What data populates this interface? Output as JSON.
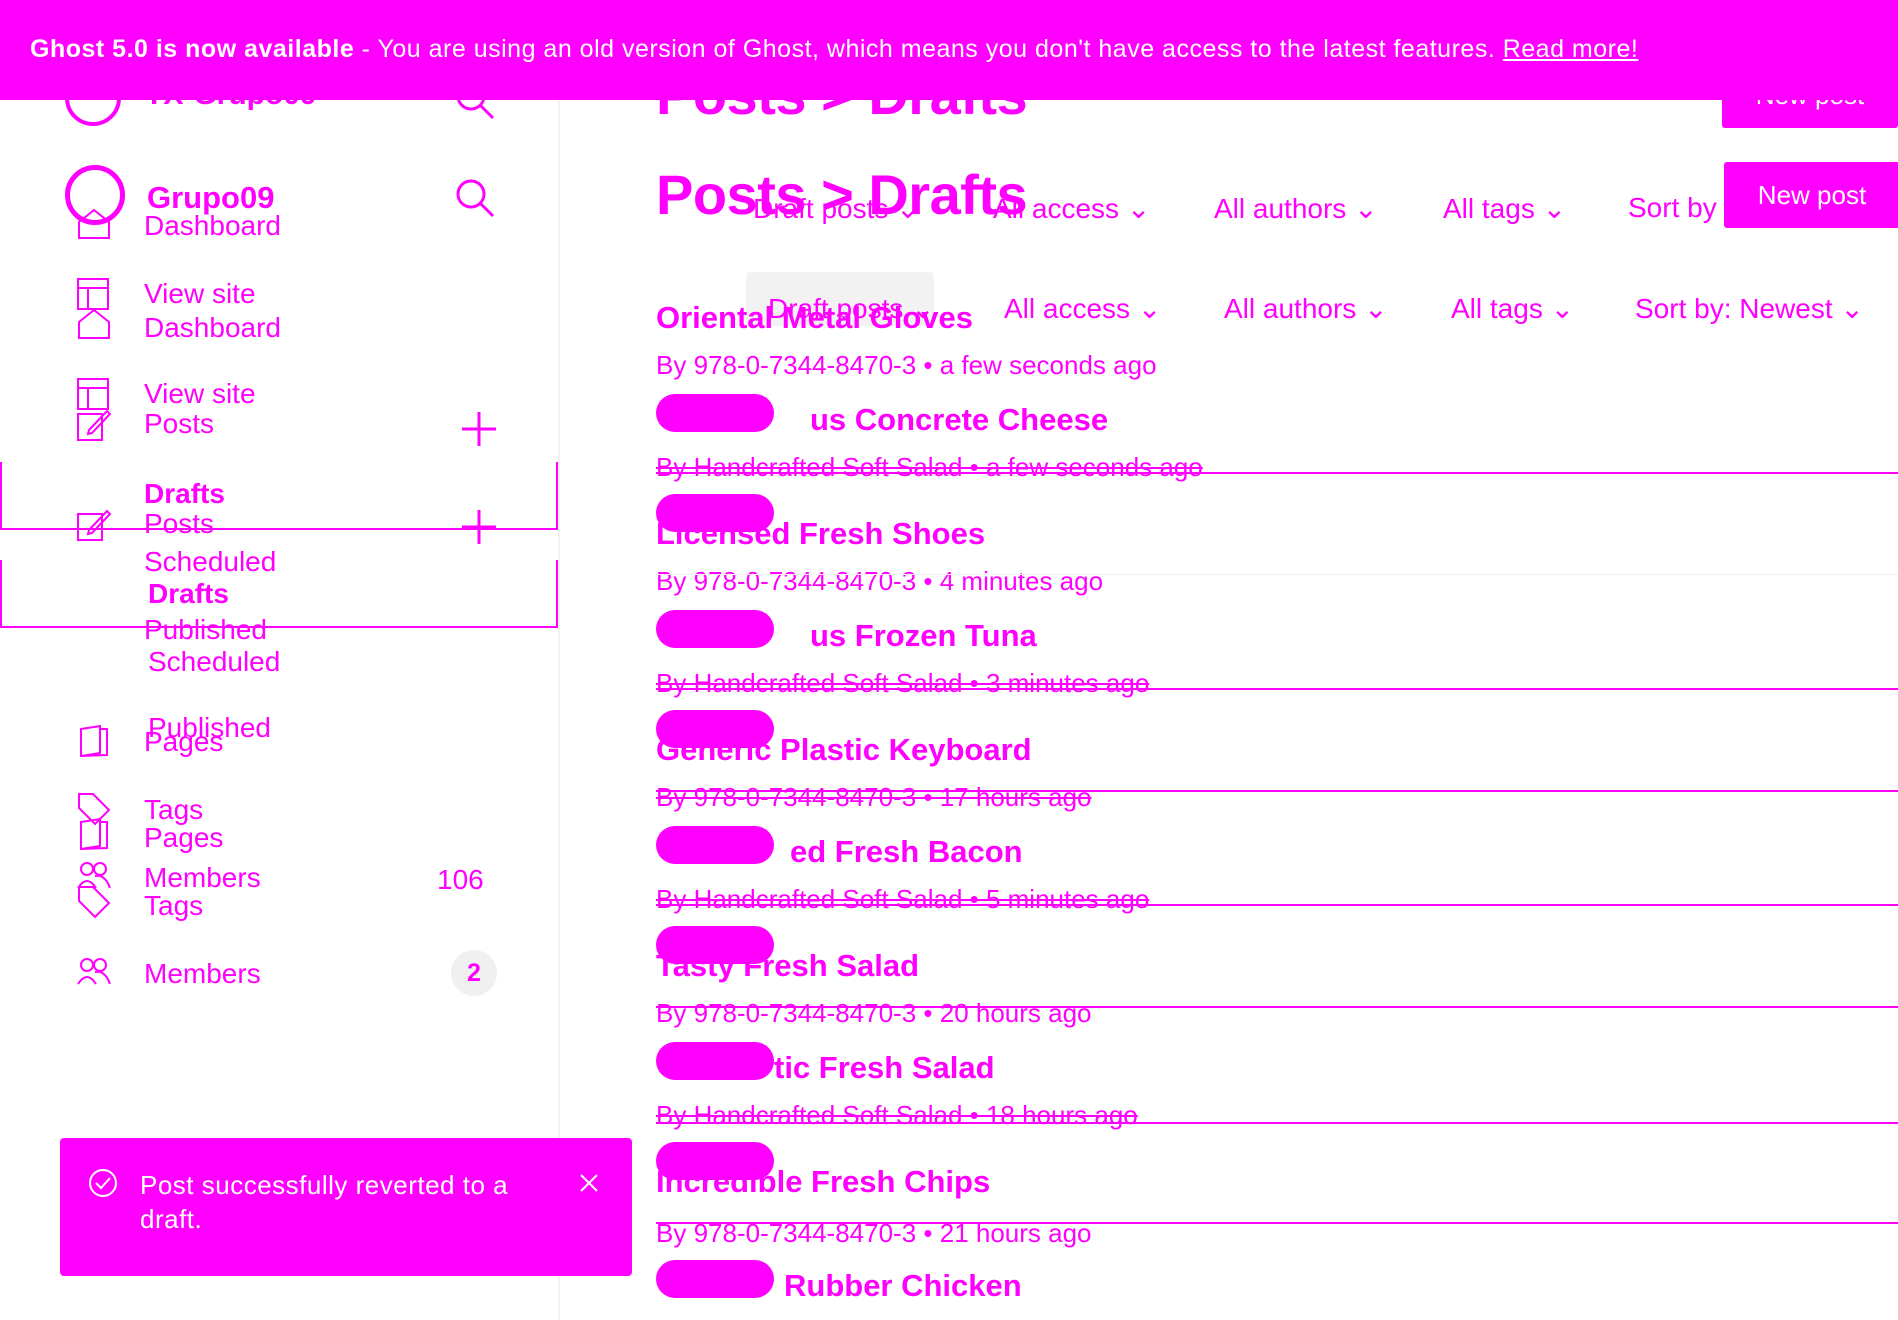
{
  "banner": {
    "title": "Ghost 5.0 is now available",
    "separator": "-",
    "message": "You are using an old version of Ghost, which means you don't have access to the latest features.",
    "link": "Read more!"
  },
  "sidebar": {
    "site_name_ghost": "TX-Grupo09",
    "site_name": "Grupo09",
    "items_ghost": {
      "dashboard": "Dashboard",
      "view_site": "View site",
      "posts": "Posts",
      "drafts": "Drafts",
      "scheduled": "Scheduled",
      "published": "Published",
      "pages": "Pages",
      "tags": "Tags",
      "members": "Members",
      "members_count": "106"
    },
    "items": {
      "dashboard": "Dashboard",
      "view_site": "View site",
      "posts": "Posts",
      "drafts": "Drafts",
      "scheduled": "Scheduled",
      "published": "Published",
      "pages": "Pages",
      "tags": "Tags",
      "members": "Members",
      "members_count": "2"
    }
  },
  "header": {
    "breadcrumb_parent": "Posts",
    "breadcrumb_sep": ">",
    "breadcrumb_current": "Drafts",
    "new_post": "New post",
    "new_post_ghost": "New post"
  },
  "filters_ghost": {
    "type": "Draft posts",
    "access": "All access",
    "authors": "All authors",
    "tags": "All tags",
    "sort": "Sort by"
  },
  "filters": {
    "type": "Draft posts",
    "access": "All access",
    "authors": "All authors",
    "tags": "All tags",
    "sort": "Sort by: Newest"
  },
  "posts": [
    {
      "title": "Oriental Metal Gloves",
      "meta": "By 978-0-7344-8470-3 • a few seconds ago"
    },
    {
      "title": "Gorgeous Concrete Cheese",
      "visible_title": "us Concrete Cheese",
      "meta": "By Handcrafted Soft Salad • a few seconds ago"
    },
    {
      "title": "Licensed Fresh Shoes",
      "meta": "By 978-0-7344-8470-3 • 4 minutes ago"
    },
    {
      "title": "Gorgeous Frozen Tuna",
      "visible_title": "us Frozen Tuna",
      "meta": "By Handcrafted Soft Salad • 3 minutes ago"
    },
    {
      "title": "Generic Plastic Keyboard",
      "meta": "By 978-0-7344-8470-3 • 17 hours ago"
    },
    {
      "title": "Licensed Fresh Bacon",
      "visible_title": "ed Fresh Bacon",
      "meta": "By Handcrafted Soft Salad • 5 minutes ago"
    },
    {
      "title": "Tasty Fresh Salad",
      "meta": "By 978-0-7344-8470-3 • 20 hours ago"
    },
    {
      "title": "Fantastic Fresh Salad",
      "visible_title": "tic Fresh Salad",
      "meta": "By Handcrafted Soft Salad • 18 hours ago"
    },
    {
      "title": "Incredible Fresh Chips",
      "meta": "By 978-0-7344-8470-3 • 21 hours ago"
    },
    {
      "title": "Rubber Chicken",
      "meta": ""
    }
  ],
  "toast": {
    "message": "Post successfully reverted to a draft."
  },
  "colors": {
    "accent": "#ff00ff",
    "background": "#ffffff",
    "text_on_accent": "#ffffff"
  }
}
